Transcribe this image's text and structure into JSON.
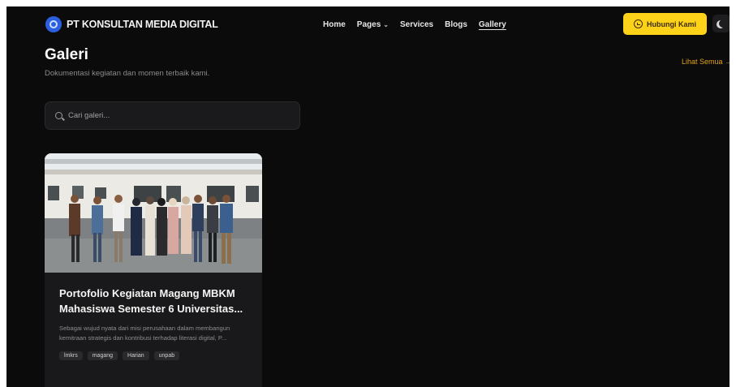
{
  "brand": {
    "name": "PT KONSULTAN MEDIA DIGITAL"
  },
  "nav": {
    "items": [
      {
        "label": "Home"
      },
      {
        "label": "Pages"
      },
      {
        "label": "Services"
      },
      {
        "label": "Blogs"
      },
      {
        "label": "Gallery"
      }
    ]
  },
  "header": {
    "contact_label": "Hubungi Kami",
    "theme_icon": "moon-icon"
  },
  "page": {
    "title": "Galeri",
    "subtitle": "Dokumentasi kegiatan dan momen terbaik kami.",
    "see_all": "Lihat Semua →"
  },
  "search": {
    "placeholder": "Cari galeri...",
    "value": ""
  },
  "gallery": {
    "items": [
      {
        "title": "Portofolio Kegiatan Magang MBKM Mahasiswa Semester 6 Universitas...",
        "description": "Sebagai wujud nyata dari misi perusahaan dalam membangun kemitraan strategis dan kontribusi terhadap literasi digital, P...",
        "tags": [
          "lmkrs",
          "magang",
          "Harian",
          "unpab"
        ]
      }
    ]
  },
  "colors": {
    "accent": "#ffd21a",
    "link": "#e0a21a",
    "background": "#0b0b0c",
    "card": "#19191b"
  }
}
